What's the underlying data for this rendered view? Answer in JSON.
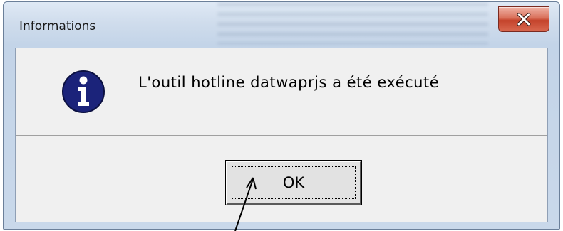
{
  "dialog": {
    "title": "Informations",
    "message": "L'outil hotline datwaprjs a été exécuté",
    "icon": "information-icon",
    "ok_label": "OK",
    "close_icon": "close-icon"
  },
  "colors": {
    "close_button": "#c4432b",
    "info_icon_fill": "#1b237a",
    "content_background": "#f0f0f0",
    "title_bar": "#cfdcec"
  },
  "annotation": {
    "icon": "arrow-pointer-icon"
  }
}
